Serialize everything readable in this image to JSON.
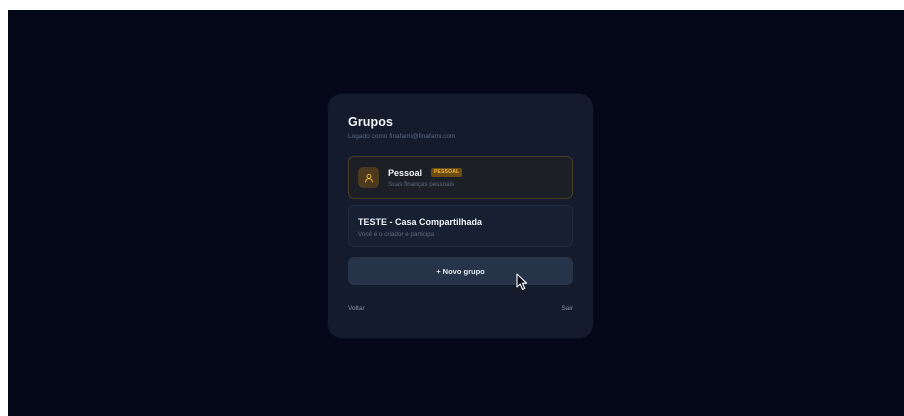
{
  "panel": {
    "title": "Grupos",
    "subtitle": "Logado como finafami@finafami.com"
  },
  "groups": [
    {
      "name": "Pessoal",
      "badge": "PESSOAL",
      "description": "Suas finanças pessoais",
      "icon": "user-icon",
      "accent": "#f5b93a"
    },
    {
      "name": "TESTE - Casa Compartilhada",
      "description": "Você é o criador e participa"
    }
  ],
  "actions": {
    "new_group_label": "+ Novo grupo",
    "back_label": "Voltar",
    "logout_label": "Sair"
  },
  "colors": {
    "background": "#050818",
    "card": "#131b2d",
    "accent": "#f5b93a"
  }
}
